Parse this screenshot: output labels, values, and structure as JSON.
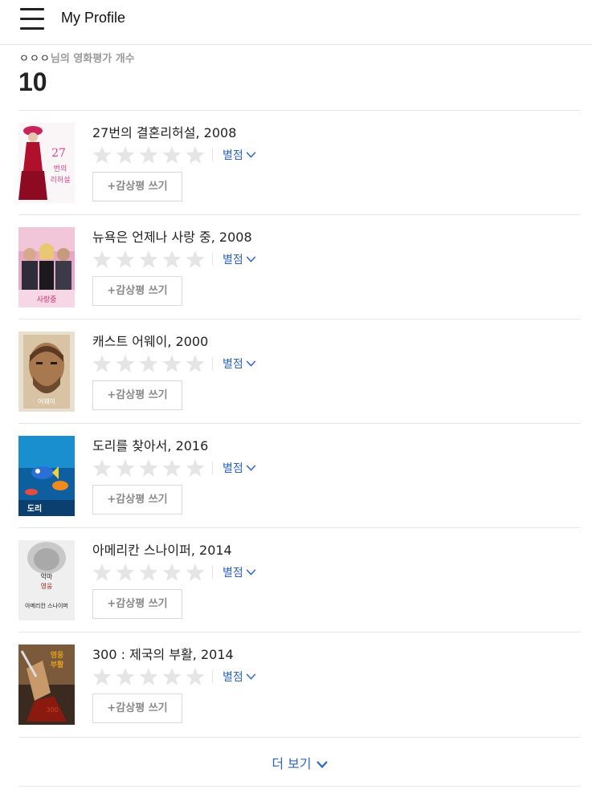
{
  "header": {
    "title": "My Profile",
    "menu_icon": "hamburger-menu-icon"
  },
  "rating_summary": {
    "user_name": "ㅇㅇㅇ",
    "label_suffix": "님의 영화평가 개수",
    "count": "10"
  },
  "rate_label": "별점",
  "review_label": "+감상평 쓰기",
  "more_label": "더 보기",
  "colors": {
    "link": "#2a64c8",
    "star_empty": "#e5e5e5",
    "divider": "#e6e6e6"
  },
  "movies": [
    {
      "title": "27번의 결혼리허설, 2008",
      "rating": 0
    },
    {
      "title": "뉴욕은 언제나 사랑 중, 2008",
      "rating": 0
    },
    {
      "title": "캐스트 어웨이, 2000",
      "rating": 0
    },
    {
      "title": "도리를 찾아서, 2016",
      "rating": 0
    },
    {
      "title": "아메리칸 스나이퍼, 2014",
      "rating": 0
    },
    {
      "title": "300 : 제국의 부활, 2014",
      "rating": 0
    }
  ]
}
